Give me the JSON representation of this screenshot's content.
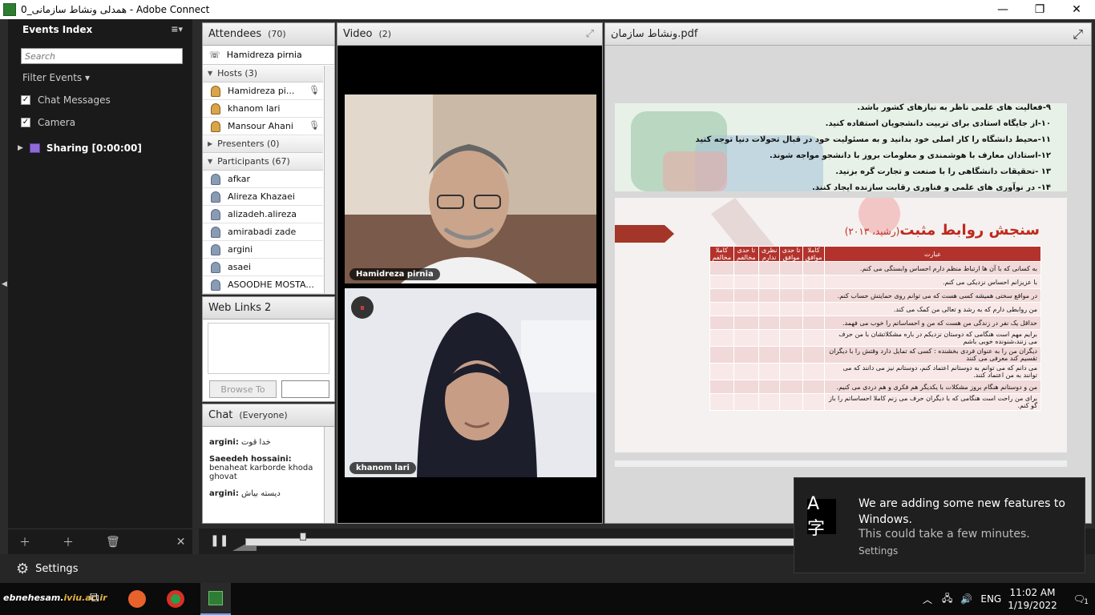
{
  "window": {
    "title": "همدلی ونشاط سازمانی_0 - Adobe Connect"
  },
  "events": {
    "title": "Events Index",
    "search_placeholder": "Search",
    "filter_label": "Filter Events",
    "items": [
      {
        "label": "Chat Messages",
        "checked": true
      },
      {
        "label": "Camera",
        "checked": true
      }
    ],
    "sharing_label": "Sharing [0:00:00]"
  },
  "attendees": {
    "title": "Attendees",
    "count": "(70)",
    "me": "Hamidreza pirnia",
    "hosts_label": "Hosts (3)",
    "hosts": [
      "Hamidreza pi...",
      "khanom lari",
      "Mansour Ahani"
    ],
    "presenters_label": "Presenters (0)",
    "participants_label": "Participants (67)",
    "participants": [
      "afkar",
      "Alireza Khazaei",
      "alizadeh.alireza",
      "amirabadi zade",
      "argini",
      "asaei",
      "ASOODHE MOSTA..."
    ]
  },
  "weblinks": {
    "title": "Web Links 2",
    "browse_label": "Browse To"
  },
  "chat": {
    "title": "Chat",
    "scope": "(Everyone)",
    "messages": [
      {
        "name": "argini:",
        "text": "خدا قوت"
      },
      {
        "name": "Saeedeh hossaini:",
        "text": "benaheat karborde khoda ghovat"
      },
      {
        "name": "argini:",
        "text": "دیسته بیاش"
      }
    ]
  },
  "video": {
    "title": "Video",
    "count": "(2)",
    "tiles": [
      {
        "name": "Hamidreza pirnia"
      },
      {
        "name": "khanom lari"
      }
    ]
  },
  "share": {
    "title": "ونشاط سازمان.pdf",
    "slide1_lines": [
      "۹-فعالیت های علمی ناظر به نیازهای کشور باشد.",
      "۱۰-از جایگاه استادی برای تربیت دانشجویان استفاده کنید.",
      "۱۱-محیط دانشگاه را کار اصلی خود بدانید و به مسئولیت خود در قبال تحولات دنیا توجه کنید",
      "۱۲-استادان معارف با هوشمندی و معلومات بروز با دانشجو مواجه شوند.",
      "۱۳ -تحقیقات دانشگاهی را با صنعت و تجارت گره بزنید.",
      "۱۴- در نوآوری های علمی و فناوری رقابت سازنده ایجاد کنند."
    ],
    "slide2_title": "سنجش روابط مثبت",
    "slide2_citation": "(رشید، ۲۰۱۳)",
    "table_header": [
      "عبارت",
      "کاملا موافق",
      "تا حدی موافق",
      "نظری ندارم",
      "تا حدی مخالفم",
      "کاملا مخالفم"
    ],
    "table_rows": [
      "به کسانی که با آن ها ارتباط منظم دارم احساس وابستگی می کنم.",
      "با عزیزانم احساس نزدیکی می کنم.",
      "در مواقع سختی همیشه کسی هست که می توانم روی حمایتش حساب کنم.",
      "من روابطی دارم که به رشد و تعالی من کمک می کند.",
      "حداقل یک نفر در زندگی من هست که من و احساساتم را خوب می فهمد.",
      "برایم مهم است هنگامی که دوستان نزدیکم در باره مشکلاتشان با من حرف می زنند،شنونده خوبی باشم",
      "دیگران من را به عنوان فردی بخشنده : کسی که تمایل دارد وقتش را با دیگران تقسیم کند معرفی می کنند",
      "می دانم که می توانم به دوستانم اعتماد کنم، دوستانم نیز می دانند که می توانند به من اعتماد کنند.",
      "من و دوستانم هنگام بروز مشکلات با یکدیگر هم فکری و هم دردی می کنیم.",
      "برای من راحت است هنگامی که با دیگران حرف می زنم کاملا احساساتم را باز گو کنم."
    ]
  },
  "settings": {
    "label": "Settings"
  },
  "toast": {
    "title": "We are adding some new features to Windows.",
    "subtitle": "This could take a few minutes.",
    "link": "Settings"
  },
  "taskbar": {
    "brand_a": "ebnehesam.",
    "brand_b": "iviu.ac.ir",
    "lang": "ENG",
    "time": "11:02 AM",
    "date": "1/19/2022",
    "notif_count": "1"
  }
}
